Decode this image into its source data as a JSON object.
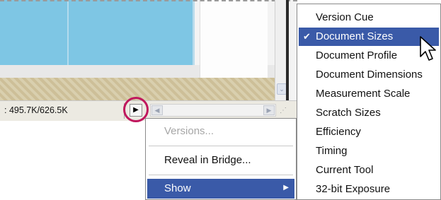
{
  "status_bar": {
    "doc_size_text": ": 495.7K/626.5K",
    "arrow_glyph": "▶",
    "scroll_left_glyph": "◀",
    "scroll_right_glyph": "▶",
    "scroll_down_glyph": "⌄",
    "grip_glyph": "⋰"
  },
  "status_menu": {
    "items": [
      {
        "label": "Versions...",
        "enabled": false
      },
      {
        "label": "Reveal in Bridge...",
        "enabled": true
      },
      {
        "label": "Show",
        "enabled": true,
        "active": true,
        "submenu_arrow": "▶"
      }
    ]
  },
  "show_submenu": {
    "check_glyph": "✔",
    "selected": "Document Sizes",
    "items": [
      {
        "label": "Version Cue"
      },
      {
        "label": "Document Sizes"
      },
      {
        "label": "Document Profile"
      },
      {
        "label": "Document Dimensions"
      },
      {
        "label": "Measurement Scale"
      },
      {
        "label": "Scratch Sizes"
      },
      {
        "label": "Efficiency"
      },
      {
        "label": "Timing"
      },
      {
        "label": "Current Tool"
      },
      {
        "label": "32-bit Exposure"
      }
    ]
  },
  "colors": {
    "menu_highlight": "#3a5aa8",
    "callout_circle": "#c0175d",
    "canvas_blue": "#7ec6e4"
  }
}
